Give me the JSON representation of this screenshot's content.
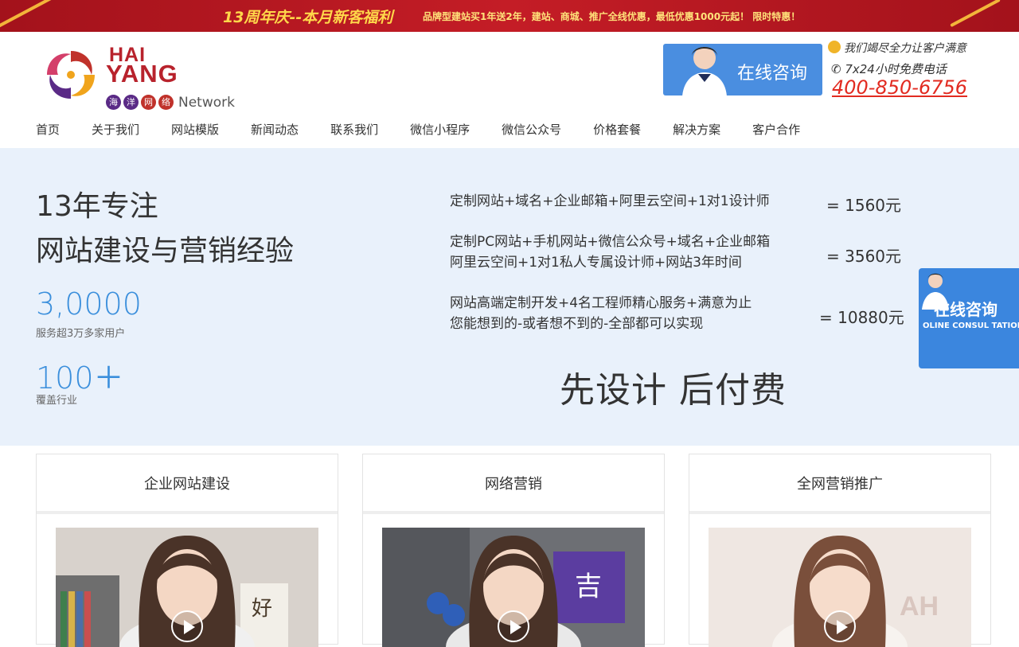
{
  "promo": {
    "headline": "13周年庆--本月新客福利",
    "offer": "品牌型建站买1年送2年，建站、商城、推广全线优惠，最低优惠1000元起！   限时特惠！"
  },
  "logo": {
    "line1": "HAI",
    "line2": "YANG",
    "chars": [
      "海",
      "洋",
      "网",
      "络"
    ],
    "chars_colors": [
      "#5a2a86",
      "#5a2a86",
      "#c0322b",
      "#c0322b"
    ],
    "suffix": "Network"
  },
  "header": {
    "consult_label": "在线咨询",
    "slogan": "我们竭尽全力让客户满意",
    "hotline_label": "7x24小时免费电话",
    "phone": "400-850-6756"
  },
  "nav": {
    "items": [
      "首页",
      "关于我们",
      "网站模版",
      "新闻动态",
      "联系我们",
      "微信小程序",
      "微信公众号",
      "价格套餐",
      "解决方案",
      "客户合作"
    ]
  },
  "hero": {
    "title_line1": "13年专注",
    "title_line2": "网站建设与营销经验",
    "stats": [
      {
        "number": "3,0000",
        "label": "服务超3万多家用户"
      },
      {
        "number": "100＋",
        "label": "覆盖行业"
      }
    ],
    "packages": [
      {
        "lines": [
          "定制网站+域名+企业邮箱+阿里云空间+1对1设计师"
        ],
        "price": "= 1560元"
      },
      {
        "lines": [
          "定制PC网站+手机网站+微信公众号+域名+企业邮箱",
          "阿里云空间+1对1私人专属设计师+网站3年时间"
        ],
        "price": "= 3560元"
      },
      {
        "lines": [
          "网站高端定制开发+4名工程师精心服务+满意为止",
          "您能想到的-或者想不到的-全部都可以实现"
        ],
        "price": "= 10880元"
      }
    ],
    "slogan": "先设计 后付费"
  },
  "float_consult": {
    "label": "在线咨询",
    "sub": "OLINE CONSUL TATION"
  },
  "cards": [
    {
      "title": "企业网站建设",
      "sign": "好"
    },
    {
      "title": "网络营销",
      "sign": "吉"
    },
    {
      "title": "全网营销推广",
      "sign": "AH"
    }
  ],
  "colors": {
    "banner_red": "#c41d26",
    "accent_blue": "#3b8fdc",
    "phone_red": "#e22b21",
    "hero_bg": "#e9f1fb"
  }
}
